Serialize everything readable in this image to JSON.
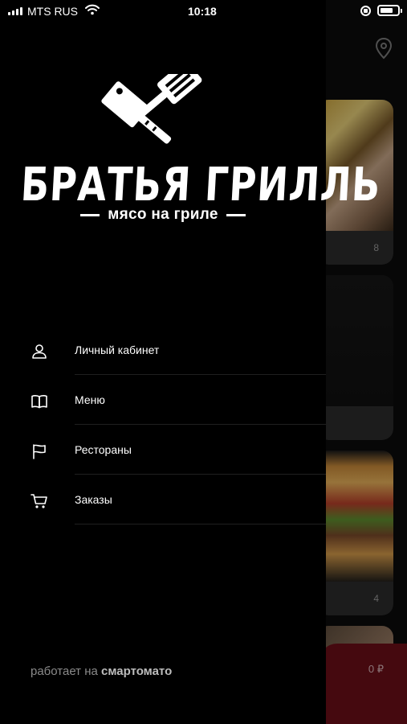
{
  "status_bar": {
    "carrier": "MTS RUS",
    "time": "10:18"
  },
  "brand": {
    "name": "БРАТЬЯ ГРИЛЛЬ",
    "tagline": "мясо на гриле"
  },
  "menu": {
    "items": [
      {
        "label": "Личный кабинет",
        "icon": "user-icon"
      },
      {
        "label": "Меню",
        "icon": "book-icon"
      },
      {
        "label": "Рестораны",
        "icon": "flag-icon"
      },
      {
        "label": "Заказы",
        "icon": "cart-icon"
      }
    ]
  },
  "footer": {
    "powered_prefix": "работает на ",
    "powered_brand": "смартомато"
  },
  "background": {
    "card_counts": [
      "8",
      "",
      "4"
    ],
    "cart_total": "0 ₽"
  },
  "colors": {
    "drawer_bg": "#000000",
    "cart_bar": "#6b0f18",
    "separator": "#1f1f1f"
  }
}
